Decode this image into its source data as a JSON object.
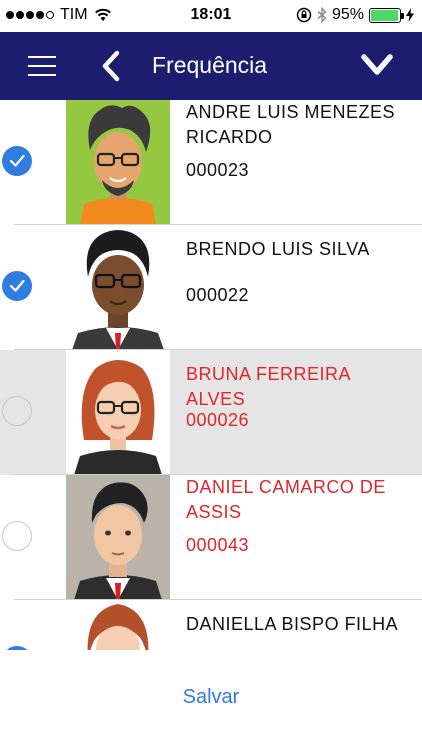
{
  "status_bar": {
    "carrier": "TIM",
    "time": "18:01",
    "battery_percent": "95%",
    "battery_level": 0.95
  },
  "nav": {
    "title": "Frequência"
  },
  "students": [
    {
      "name": "ANDRE LUIS MENEZES RICARDO",
      "code": "000023",
      "checked": true,
      "highlight": false,
      "name_color": "#111111"
    },
    {
      "name": "BRENDO LUIS SILVA",
      "code": "000022",
      "checked": true,
      "highlight": false,
      "name_color": "#111111"
    },
    {
      "name": "BRUNA FERREIRA ALVES",
      "code": "000026",
      "checked": false,
      "highlight": true,
      "name_color": "#e0262c"
    },
    {
      "name": "DANIEL CAMARCO DE ASSIS",
      "code": "000043",
      "checked": false,
      "highlight": false,
      "name_color": "#e0262c"
    },
    {
      "name": "DANIELLA BISPO FILHA",
      "code": "",
      "checked": true,
      "highlight": false,
      "name_color": "#111111"
    }
  ],
  "footer": {
    "save_label": "Salvar"
  },
  "colors": {
    "nav_background": "#1c1d6e",
    "accent": "#2f7de1",
    "absent_red": "#e0262c"
  }
}
